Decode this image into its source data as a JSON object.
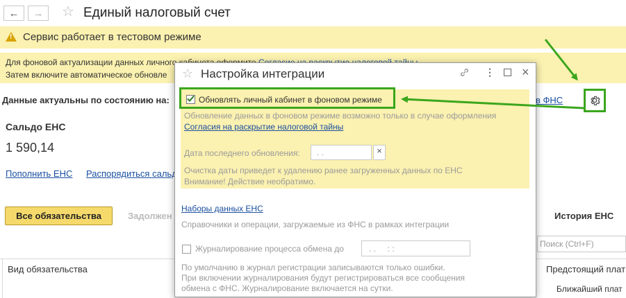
{
  "header": {
    "back_glyph": "←",
    "forward_glyph": "→",
    "title": "Единый налоговый счет"
  },
  "banner": {
    "text": "Сервис работает в тестовом режиме"
  },
  "info": {
    "line1_prefix": "Для фоновой актуализации данных личного кабинета оформите ",
    "line1_link": "Согласие на раскрытие налоговой тайны",
    "line2": "Затем включите автоматическое обновле"
  },
  "status": {
    "label": "Данные актуальны по состоянию на:",
    "fns_link": "в ФНС"
  },
  "saldo": {
    "title": "Сальдо ЕНС",
    "value": "1 590,14",
    "replenish_link": "Пополнить ЕНС",
    "dispose_link": "Распорядиться сальд"
  },
  "tabs": {
    "all": "Все обязательства",
    "debt": "Задолжен",
    "history": "История ЕНС"
  },
  "search": {
    "placeholder": "Поиск (Ctrl+F)"
  },
  "table": {
    "col_type": "Вид обязательства",
    "col_upcoming": "Предстоящий плат",
    "col_nearest": "Ближайший плат"
  },
  "dialog": {
    "title": "Настройка интеграции",
    "update_checkbox_label": "Обновлять личный кабинет в фоновом режиме",
    "update_checked": true,
    "note1": "Обновление данных в фоновом режиме возможно только в случае оформления",
    "consent_link": "Согласия на раскрытие налоговой тайны",
    "last_update_label": "Дата последнего обновления:",
    "last_update_value": ". .",
    "clear_glyph": "×",
    "warning_line1": "Очистка даты приведет к удалению ранее загруженных данных по ЕНС",
    "warning_line2": "Внимание! Действие необратимо.",
    "datasets_link": "Наборы данных ЕНС",
    "datasets_desc": "Справочники и операции, загружаемые из ФНС в рамках интеграции",
    "logging_label": "Журналирование процесса обмена до",
    "logging_value": ". .     : :",
    "logging_note1": "По умолчанию в журнал регистрации записываются только ошибки.",
    "logging_note2": "При включении журналирования будут регистрироваться все сообщения",
    "logging_note3": "обмена с ФНС. Журналирование включается на сутки."
  },
  "colors": {
    "banner": "#fbf1b0",
    "accent_green": "#3aa61d",
    "link": "#1a4fa0",
    "primary_button": "#f5d96b"
  }
}
